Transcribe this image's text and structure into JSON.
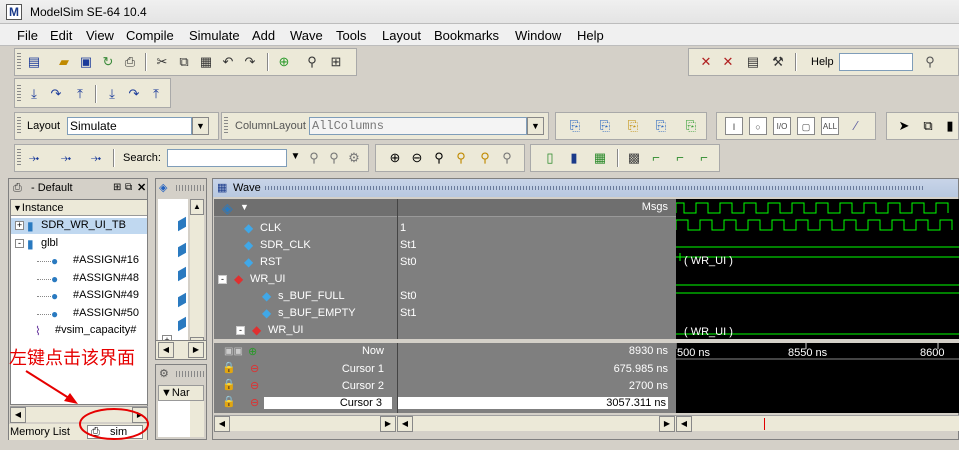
{
  "window": {
    "title": "ModelSim SE-64 10.4",
    "logo": "M"
  },
  "menu": [
    "File",
    "Edit",
    "View",
    "Compile",
    "Simulate",
    "Add",
    "Wave",
    "Tools",
    "Layout",
    "Bookmarks",
    "Window",
    "Help"
  ],
  "toolbar": {
    "help_label": "Help",
    "help_value": "",
    "layout_label": "Layout",
    "layout_value": "Simulate",
    "column_layout_label": "ColumnLayout",
    "column_layout_value": "AllColumns",
    "search_label": "Search:",
    "search_value": ""
  },
  "sim_panel": {
    "title": "- Default",
    "column_header": "Instance",
    "items": [
      {
        "label": "SDR_WR_UI_TB",
        "level": 0,
        "expand": "+",
        "selected": true
      },
      {
        "label": "glbl",
        "level": 0,
        "expand": "-"
      },
      {
        "label": "#ASSIGN#16",
        "level": 1
      },
      {
        "label": "#ASSIGN#48",
        "level": 1
      },
      {
        "label": "#ASSIGN#49",
        "level": 1
      },
      {
        "label": "#ASSIGN#50",
        "level": 1
      },
      {
        "label": "#vsim_capacity#",
        "level": 0
      }
    ],
    "tabs": {
      "memory_list": "Memory List",
      "sim": "sim"
    }
  },
  "annotation": "左键点击该界面",
  "wave": {
    "title": "Wave",
    "msgs_header": "Msgs",
    "signals": [
      {
        "name": "CLK",
        "value": "1",
        "indent": 1
      },
      {
        "name": "SDR_CLK",
        "value": "St1",
        "indent": 1
      },
      {
        "name": "RST",
        "value": "St0",
        "indent": 1
      },
      {
        "name": "WR_UI",
        "value": "",
        "indent": 0,
        "group": true
      },
      {
        "name": "s_BUF_FULL",
        "value": "St0",
        "indent": 2
      },
      {
        "name": "s_BUF_EMPTY",
        "value": "St1",
        "indent": 2
      },
      {
        "name": "WR_UI",
        "value": "",
        "indent": 1,
        "group": true
      }
    ],
    "wave_labels": [
      "( WR_UI )",
      "( WR_UI )"
    ],
    "now_label": "Now",
    "now_value": "8930 ns",
    "cursors": [
      {
        "label": "Cursor 1",
        "value": "675.985 ns"
      },
      {
        "label": "Cursor 2",
        "value": "2700 ns"
      },
      {
        "label": "Cursor 3",
        "value": "3057.311 ns"
      }
    ],
    "time_ticks": [
      "500 ns",
      "8550 ns",
      "8600"
    ]
  },
  "colors": {
    "wave_green": "#00ff00",
    "annotation_red": "#e60000",
    "selected_bg": "#c0d8f0"
  }
}
